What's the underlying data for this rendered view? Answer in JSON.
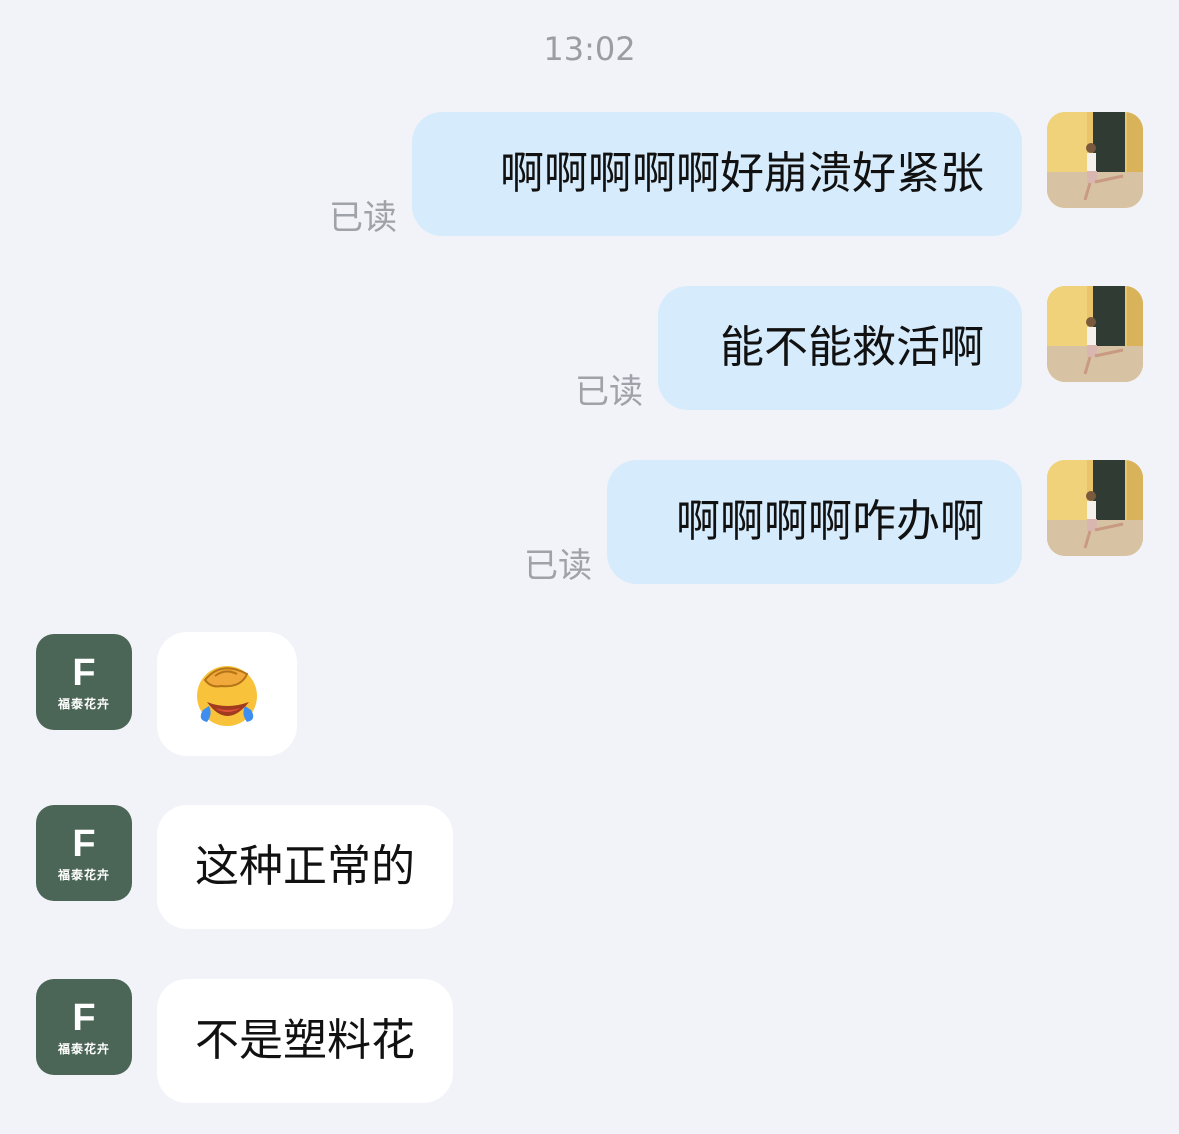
{
  "timestamp": "13:02",
  "messages_out": [
    {
      "text": "啊啊啊啊啊好崩溃好紧张",
      "status": "已读"
    },
    {
      "text": "能不能救活啊",
      "status": "已读"
    },
    {
      "text": "啊啊啊啊咋办啊",
      "status": "已读"
    }
  ],
  "shop": {
    "avatar_letter": "F",
    "avatar_name": "福泰花卉"
  },
  "messages_in": [
    {
      "emoji": "facepalm-laugh-cry-emoji"
    },
    {
      "text": "这种正常的"
    },
    {
      "text": "不是塑料花"
    }
  ],
  "colors": {
    "background": "#f2f3f8",
    "outgoing_bubble": "#d6ebfb",
    "incoming_bubble": "#ffffff",
    "shop_avatar": "#4b6556",
    "read_status": "#9fa2a8"
  }
}
